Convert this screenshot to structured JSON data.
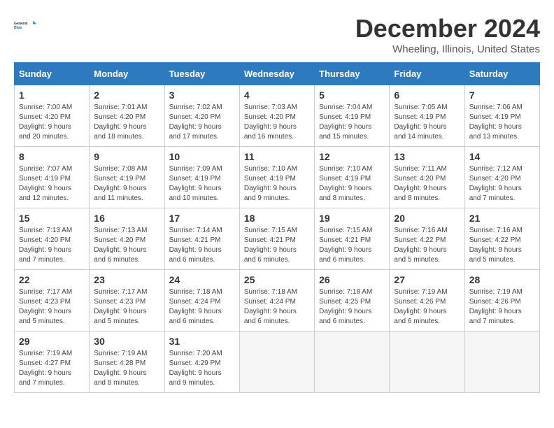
{
  "logo": {
    "line1": "General",
    "line2": "Blue"
  },
  "title": "December 2024",
  "subtitle": "Wheeling, Illinois, United States",
  "days_of_week": [
    "Sunday",
    "Monday",
    "Tuesday",
    "Wednesday",
    "Thursday",
    "Friday",
    "Saturday"
  ],
  "weeks": [
    [
      {
        "day": "1",
        "info": "Sunrise: 7:00 AM\nSunset: 4:20 PM\nDaylight: 9 hours\nand 20 minutes."
      },
      {
        "day": "2",
        "info": "Sunrise: 7:01 AM\nSunset: 4:20 PM\nDaylight: 9 hours\nand 18 minutes."
      },
      {
        "day": "3",
        "info": "Sunrise: 7:02 AM\nSunset: 4:20 PM\nDaylight: 9 hours\nand 17 minutes."
      },
      {
        "day": "4",
        "info": "Sunrise: 7:03 AM\nSunset: 4:20 PM\nDaylight: 9 hours\nand 16 minutes."
      },
      {
        "day": "5",
        "info": "Sunrise: 7:04 AM\nSunset: 4:19 PM\nDaylight: 9 hours\nand 15 minutes."
      },
      {
        "day": "6",
        "info": "Sunrise: 7:05 AM\nSunset: 4:19 PM\nDaylight: 9 hours\nand 14 minutes."
      },
      {
        "day": "7",
        "info": "Sunrise: 7:06 AM\nSunset: 4:19 PM\nDaylight: 9 hours\nand 13 minutes."
      }
    ],
    [
      {
        "day": "8",
        "info": "Sunrise: 7:07 AM\nSunset: 4:19 PM\nDaylight: 9 hours\nand 12 minutes."
      },
      {
        "day": "9",
        "info": "Sunrise: 7:08 AM\nSunset: 4:19 PM\nDaylight: 9 hours\nand 11 minutes."
      },
      {
        "day": "10",
        "info": "Sunrise: 7:09 AM\nSunset: 4:19 PM\nDaylight: 9 hours\nand 10 minutes."
      },
      {
        "day": "11",
        "info": "Sunrise: 7:10 AM\nSunset: 4:19 PM\nDaylight: 9 hours\nand 9 minutes."
      },
      {
        "day": "12",
        "info": "Sunrise: 7:10 AM\nSunset: 4:19 PM\nDaylight: 9 hours\nand 8 minutes."
      },
      {
        "day": "13",
        "info": "Sunrise: 7:11 AM\nSunset: 4:20 PM\nDaylight: 9 hours\nand 8 minutes."
      },
      {
        "day": "14",
        "info": "Sunrise: 7:12 AM\nSunset: 4:20 PM\nDaylight: 9 hours\nand 7 minutes."
      }
    ],
    [
      {
        "day": "15",
        "info": "Sunrise: 7:13 AM\nSunset: 4:20 PM\nDaylight: 9 hours\nand 7 minutes."
      },
      {
        "day": "16",
        "info": "Sunrise: 7:13 AM\nSunset: 4:20 PM\nDaylight: 9 hours\nand 6 minutes."
      },
      {
        "day": "17",
        "info": "Sunrise: 7:14 AM\nSunset: 4:21 PM\nDaylight: 9 hours\nand 6 minutes."
      },
      {
        "day": "18",
        "info": "Sunrise: 7:15 AM\nSunset: 4:21 PM\nDaylight: 9 hours\nand 6 minutes."
      },
      {
        "day": "19",
        "info": "Sunrise: 7:15 AM\nSunset: 4:21 PM\nDaylight: 9 hours\nand 6 minutes."
      },
      {
        "day": "20",
        "info": "Sunrise: 7:16 AM\nSunset: 4:22 PM\nDaylight: 9 hours\nand 5 minutes."
      },
      {
        "day": "21",
        "info": "Sunrise: 7:16 AM\nSunset: 4:22 PM\nDaylight: 9 hours\nand 5 minutes."
      }
    ],
    [
      {
        "day": "22",
        "info": "Sunrise: 7:17 AM\nSunset: 4:23 PM\nDaylight: 9 hours\nand 5 minutes."
      },
      {
        "day": "23",
        "info": "Sunrise: 7:17 AM\nSunset: 4:23 PM\nDaylight: 9 hours\nand 5 minutes."
      },
      {
        "day": "24",
        "info": "Sunrise: 7:18 AM\nSunset: 4:24 PM\nDaylight: 9 hours\nand 6 minutes."
      },
      {
        "day": "25",
        "info": "Sunrise: 7:18 AM\nSunset: 4:24 PM\nDaylight: 9 hours\nand 6 minutes."
      },
      {
        "day": "26",
        "info": "Sunrise: 7:18 AM\nSunset: 4:25 PM\nDaylight: 9 hours\nand 6 minutes."
      },
      {
        "day": "27",
        "info": "Sunrise: 7:19 AM\nSunset: 4:26 PM\nDaylight: 9 hours\nand 6 minutes."
      },
      {
        "day": "28",
        "info": "Sunrise: 7:19 AM\nSunset: 4:26 PM\nDaylight: 9 hours\nand 7 minutes."
      }
    ],
    [
      {
        "day": "29",
        "info": "Sunrise: 7:19 AM\nSunset: 4:27 PM\nDaylight: 9 hours\nand 7 minutes."
      },
      {
        "day": "30",
        "info": "Sunrise: 7:19 AM\nSunset: 4:28 PM\nDaylight: 9 hours\nand 8 minutes."
      },
      {
        "day": "31",
        "info": "Sunrise: 7:20 AM\nSunset: 4:29 PM\nDaylight: 9 hours\nand 9 minutes."
      },
      {
        "day": "",
        "info": ""
      },
      {
        "day": "",
        "info": ""
      },
      {
        "day": "",
        "info": ""
      },
      {
        "day": "",
        "info": ""
      }
    ]
  ]
}
